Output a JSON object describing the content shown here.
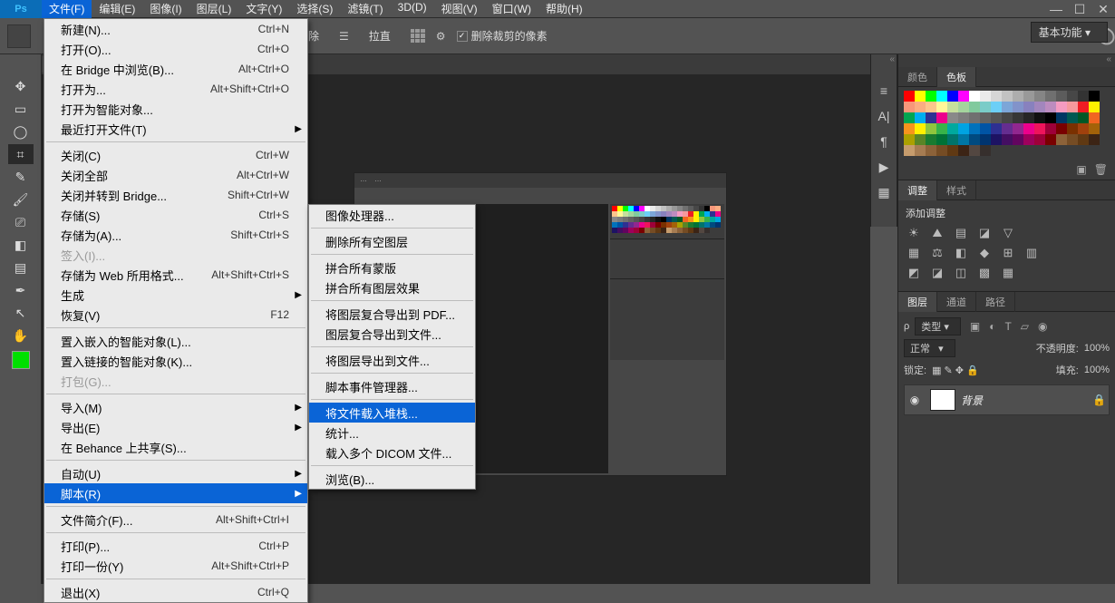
{
  "app": {
    "logo": "Ps"
  },
  "menubar": [
    "文件(F)",
    "编辑(E)",
    "图像(I)",
    "图层(L)",
    "文字(Y)",
    "选择(S)",
    "滤镜(T)",
    "3D(D)",
    "视图(V)",
    "窗口(W)",
    "帮助(H)"
  ],
  "menubar_open_index": 0,
  "options_bar": {
    "clear_btn": "清除",
    "straighten_btn": "拉直",
    "delete_cropped": "删除裁剪的像素",
    "workspace": "基本功能"
  },
  "doc_tab": {
    "close": "×"
  },
  "file_menu": [
    {
      "label": "新建(N)...",
      "sc": "Ctrl+N"
    },
    {
      "label": "打开(O)...",
      "sc": "Ctrl+O"
    },
    {
      "label": "在 Bridge 中浏览(B)...",
      "sc": "Alt+Ctrl+O"
    },
    {
      "label": "打开为...",
      "sc": "Alt+Shift+Ctrl+O"
    },
    {
      "label": "打开为智能对象..."
    },
    {
      "label": "最近打开文件(T)",
      "sub": true
    },
    {
      "sep": true
    },
    {
      "label": "关闭(C)",
      "sc": "Ctrl+W"
    },
    {
      "label": "关闭全部",
      "sc": "Alt+Ctrl+W"
    },
    {
      "label": "关闭并转到 Bridge...",
      "sc": "Shift+Ctrl+W"
    },
    {
      "label": "存储(S)",
      "sc": "Ctrl+S"
    },
    {
      "label": "存储为(A)...",
      "sc": "Shift+Ctrl+S"
    },
    {
      "label": "签入(I)...",
      "dis": true
    },
    {
      "label": "存储为 Web 所用格式...",
      "sc": "Alt+Shift+Ctrl+S"
    },
    {
      "label": "生成",
      "sub": true
    },
    {
      "label": "恢复(V)",
      "sc": "F12"
    },
    {
      "sep": true
    },
    {
      "label": "置入嵌入的智能对象(L)..."
    },
    {
      "label": "置入链接的智能对象(K)..."
    },
    {
      "label": "打包(G)...",
      "dis": true
    },
    {
      "sep": true
    },
    {
      "label": "导入(M)",
      "sub": true
    },
    {
      "label": "导出(E)",
      "sub": true
    },
    {
      "label": "在 Behance 上共享(S)..."
    },
    {
      "sep": true
    },
    {
      "label": "自动(U)",
      "sub": true
    },
    {
      "label": "脚本(R)",
      "sub": true,
      "hl": true
    },
    {
      "sep": true
    },
    {
      "label": "文件简介(F)...",
      "sc": "Alt+Shift+Ctrl+I"
    },
    {
      "sep": true
    },
    {
      "label": "打印(P)...",
      "sc": "Ctrl+P"
    },
    {
      "label": "打印一份(Y)",
      "sc": "Alt+Shift+Ctrl+P"
    },
    {
      "sep": true
    },
    {
      "label": "退出(X)",
      "sc": "Ctrl+Q"
    }
  ],
  "scripts_menu": [
    {
      "label": "图像处理器..."
    },
    {
      "sep": true
    },
    {
      "label": "删除所有空图层"
    },
    {
      "sep": true
    },
    {
      "label": "拼合所有蒙版"
    },
    {
      "label": "拼合所有图层效果"
    },
    {
      "sep": true
    },
    {
      "label": "将图层复合导出到 PDF..."
    },
    {
      "label": "图层复合导出到文件..."
    },
    {
      "sep": true
    },
    {
      "label": "将图层导出到文件..."
    },
    {
      "sep": true
    },
    {
      "label": "脚本事件管理器..."
    },
    {
      "sep": true
    },
    {
      "label": "将文件载入堆栈...",
      "hl": true
    },
    {
      "label": "统计..."
    },
    {
      "label": "载入多个 DICOM 文件..."
    },
    {
      "sep": true
    },
    {
      "label": "浏览(B)..."
    }
  ],
  "right_panels": {
    "color_tab": "颜色",
    "swatches_tab": "色板",
    "adjust_tab": "调整",
    "styles_tab": "样式",
    "add_adjust": "添加调整",
    "layers_tab": "图层",
    "channels_tab": "通道",
    "paths_tab": "路径",
    "kind_label": "类型",
    "blend_normal": "正常",
    "opacity_label": "不透明度:",
    "opacity_val": "100%",
    "lock_label": "锁定:",
    "fill_label": "填充:",
    "fill_val": "100%",
    "layer0_name": "背景"
  },
  "swatch_colors": [
    "#ff0000",
    "#ffff00",
    "#00ff00",
    "#00ffff",
    "#0000ff",
    "#ff00ff",
    "#ffffff",
    "#ebebeb",
    "#d6d6d6",
    "#c2c2c2",
    "#adadad",
    "#999999",
    "#858585",
    "#707070",
    "#5c5c5c",
    "#474747",
    "#333333",
    "#000000",
    "#f7977a",
    "#fbad82",
    "#fdc68c",
    "#fff799",
    "#c6df9c",
    "#a4d49d",
    "#81ca9d",
    "#7accc8",
    "#6ccff7",
    "#7ca6d8",
    "#8293ca",
    "#8881be",
    "#a286bd",
    "#bc8cbf",
    "#f49bc1",
    "#f5999d",
    "#ee1d24",
    "#fff100",
    "#00a650",
    "#00aeef",
    "#2f3192",
    "#ed008c",
    "#898989",
    "#7d7d7d",
    "#707070",
    "#626262",
    "#555555",
    "#464646",
    "#363636",
    "#262626",
    "#111111",
    "#000000",
    "#003663",
    "#005952",
    "#005826",
    "#f16522",
    "#f7941d",
    "#fff100",
    "#8fc63d",
    "#37b44a",
    "#00a99e",
    "#00a3e2",
    "#0072bc",
    "#0054a5",
    "#2e3092",
    "#652d90",
    "#91278f",
    "#ec008c",
    "#ee145b",
    "#9e0039",
    "#790000",
    "#7a3000",
    "#a0410d",
    "#a36209",
    "#aba000",
    "#598526",
    "#197b30",
    "#007236",
    "#00746b",
    "#0076a4",
    "#004a80",
    "#003470",
    "#1d1363",
    "#440e62",
    "#62055f",
    "#9e005c",
    "#9e0039",
    "#790000",
    "#8c6239",
    "#754c24",
    "#603913",
    "#3c2415",
    "#c69c6d",
    "#a67c52",
    "#8c6239",
    "#754c24",
    "#603913",
    "#3c2415",
    "#534741",
    "#362f2d"
  ]
}
